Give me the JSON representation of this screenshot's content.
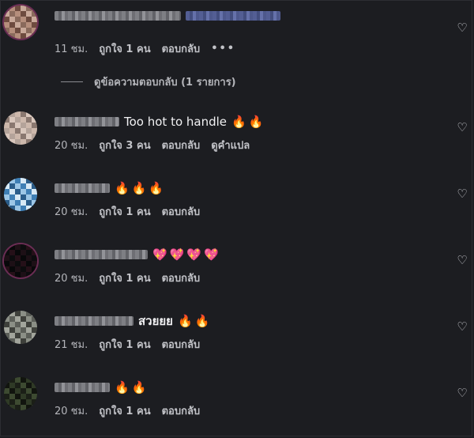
{
  "comments": [
    {
      "name_blurred": true,
      "text": "",
      "emojis": "",
      "time": "11 ชม.",
      "likes": "ถูกใจ 1 คน",
      "reply": "ตอบกลับ",
      "extra": "•••",
      "avatar_colors": [
        "#8a6a5c",
        "#c9a99a",
        "#6e4b3f",
        "#b58e7c"
      ]
    },
    {
      "name_blurred": true,
      "text": "Too hot to handle",
      "emojis": "🔥🔥",
      "time": "20 ชม.",
      "likes": "ถูกใจ 3 คน",
      "reply": "ตอบกลับ",
      "extra": "ดูคำแปล",
      "avatar_colors": [
        "#b4a39a",
        "#d9c7bd",
        "#8a7870",
        "#cdb8ac"
      ]
    },
    {
      "name_blurred": true,
      "text": "",
      "emojis": "🔥🔥🔥",
      "time": "20 ชม.",
      "likes": "ถูกใจ 1 คน",
      "reply": "ตอบกลับ",
      "extra": "",
      "avatar_colors": [
        "#3f7fb5",
        "#9cc6e6",
        "#2b5d8a",
        "#d8e9f5"
      ]
    },
    {
      "name_blurred": true,
      "text": "",
      "emojis": "💖💖💖💖",
      "time": "20 ชม.",
      "likes": "ถูกใจ 1 คน",
      "reply": "ตอบกลับ",
      "extra": "",
      "avatar_colors": [
        "#0c0c0e",
        "#1d1016",
        "#08080a",
        "#251018"
      ]
    },
    {
      "name_blurred": true,
      "text": "สวยยย",
      "emojis": "🔥🔥",
      "time": "21 ชม.",
      "likes": "ถูกใจ 1 คน",
      "reply": "ตอบกลับ",
      "extra": "",
      "avatar_colors": [
        "#5b5e58",
        "#8b8f86",
        "#3e403b",
        "#a2a59c"
      ]
    },
    {
      "name_blurred": true,
      "text": "",
      "emojis": "🔥🔥",
      "time": "20 ชม.",
      "likes": "ถูกใจ 1 คน",
      "reply": "ตอบกลับ",
      "extra": "",
      "avatar_colors": [
        "#1b1f17",
        "#2f3a26",
        "#11140e",
        "#3d4a31"
      ]
    }
  ],
  "view_replies": "ดูข้อความตอบกลับ (1 รายการ)",
  "heart_icon": "heart-outline-icon"
}
